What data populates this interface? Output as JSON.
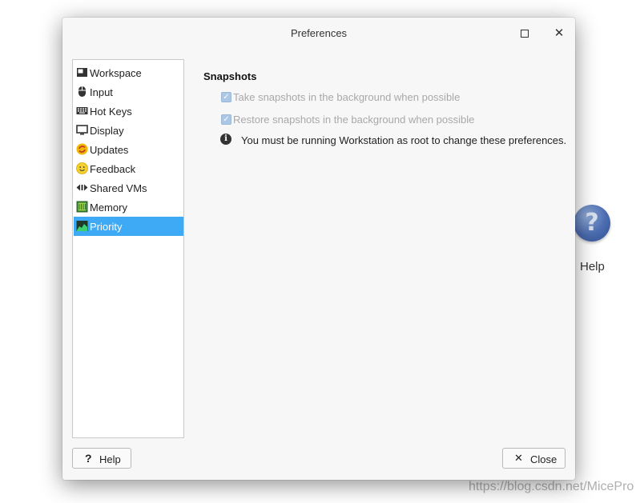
{
  "window": {
    "title": "Preferences",
    "maximize_icon": "maximize-icon",
    "close_icon": "close-icon"
  },
  "sidebar": {
    "items": [
      {
        "label": "Workspace",
        "icon": "workspace-icon",
        "selected": false
      },
      {
        "label": "Input",
        "icon": "mouse-icon",
        "selected": false
      },
      {
        "label": "Hot Keys",
        "icon": "keyboard-icon",
        "selected": false
      },
      {
        "label": "Display",
        "icon": "monitor-icon",
        "selected": false
      },
      {
        "label": "Updates",
        "icon": "updates-icon",
        "selected": false
      },
      {
        "label": "Feedback",
        "icon": "smiley-icon",
        "selected": false
      },
      {
        "label": "Shared VMs",
        "icon": "shared-vms-icon",
        "selected": false
      },
      {
        "label": "Memory",
        "icon": "memory-chip-icon",
        "selected": false
      },
      {
        "label": "Priority",
        "icon": "priority-icon",
        "selected": true
      }
    ],
    "selected_color": "#3ea9f5"
  },
  "content": {
    "section_title": "Snapshots",
    "options": [
      {
        "label": "Take snapshots in the background when possible",
        "checked": true,
        "enabled": false
      },
      {
        "label": "Restore snapshots in the background when possible",
        "checked": true,
        "enabled": false
      }
    ],
    "info_message": "You must be running Workstation as root to change these preferences."
  },
  "buttons": {
    "help_label": "Help",
    "close_label": "Close"
  },
  "background": {
    "help_icon_label": "Help"
  },
  "watermark": "https://blog.csdn.net/MicePro"
}
